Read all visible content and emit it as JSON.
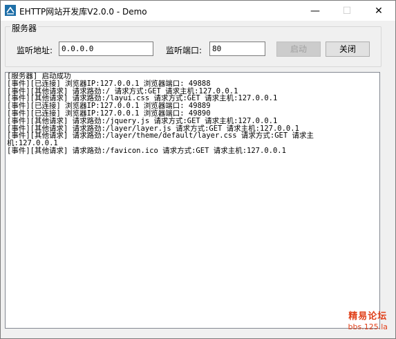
{
  "window": {
    "title": "EHTTP网站开发库V2.0.0 - Demo",
    "controls": {
      "minimize": "—",
      "maximize": "☐",
      "close": "✕"
    }
  },
  "server_group": {
    "label": "服务器",
    "address_label": "监听地址:",
    "address_value": "0.0.0.0",
    "port_label": "监听端口:",
    "port_value": "80",
    "start_button": "启动",
    "close_button": "关闭"
  },
  "log": {
    "lines": [
      "[服务器] 启动成功",
      "[事件][已连接] 浏览器IP:127.0.0.1 浏览器端口: 49888",
      "[事件][其他请求] 请求路劲:/ 请求方式:GET 请求主机:127.0.0.1",
      "[事件][其他请求] 请求路劲:/layui.css 请求方式:GET 请求主机:127.0.0.1",
      "[事件][已连接] 浏览器IP:127.0.0.1 浏览器端口: 49889",
      "[事件][已连接] 浏览器IP:127.0.0.1 浏览器端口: 49890",
      "[事件][其他请求] 请求路劲:/jquery.js 请求方式:GET 请求主机:127.0.0.1",
      "[事件][其他请求] 请求路劲:/layer/layer.js 请求方式:GET 请求主机:127.0.0.1",
      "[事件][其他请求] 请求路劲:/layer/theme/default/layer.css 请求方式:GET 请求主",
      "机:127.0.0.1",
      "[事件][其他请求] 请求路劲:/favicon.ico 请求方式:GET 请求主机:127.0.0.1"
    ]
  },
  "watermark": {
    "line1": "精易论坛",
    "line2": "bbs.125.la"
  },
  "colors": {
    "accent": "#1e6fa8",
    "watermark": "#e0401a"
  }
}
